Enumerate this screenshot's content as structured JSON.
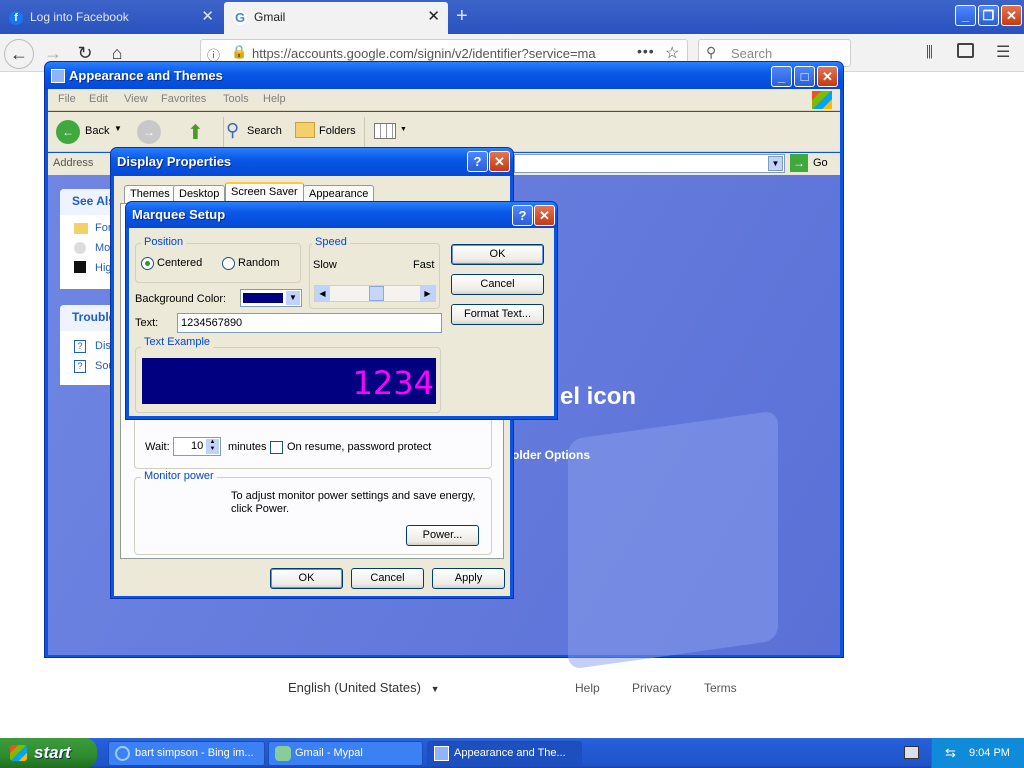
{
  "browser": {
    "tabs": [
      {
        "label": "Log into Facebook",
        "active": false
      },
      {
        "label": "Gmail",
        "active": true
      }
    ],
    "url": "https://accounts.google.com/signin/v2/identifier?service=ma",
    "search_placeholder": "Search"
  },
  "explorer": {
    "title": "Appearance and Themes",
    "menu": [
      "File",
      "Edit",
      "View",
      "Favorites",
      "Tools",
      "Help"
    ],
    "toolbar": {
      "back": "Back",
      "search": "Search",
      "folders": "Folders"
    },
    "address_label": "Address",
    "go_label": "Go",
    "see_also_header": "See Also",
    "see_also_items": [
      "Fonts",
      "Mouse Pointers",
      "High Contrast"
    ],
    "troubleshooters_header": "Troubleshooters",
    "troubleshooter_items": [
      "Display",
      "Sound"
    ],
    "panel_heading": "el icon",
    "folder_options": "older Options"
  },
  "display_properties": {
    "title": "Display Properties",
    "tabs": [
      "Themes",
      "Desktop",
      "Screen Saver",
      "Appearance"
    ],
    "wait_label": "Wait:",
    "wait_value": "10",
    "minutes_label": "minutes",
    "resume_label": "On resume, password protect",
    "monitor_power_label": "Monitor power",
    "monitor_power_text": "To adjust monitor power settings and save energy, click Power.",
    "power_button": "Power...",
    "ok": "OK",
    "cancel": "Cancel",
    "apply": "Apply"
  },
  "marquee": {
    "title": "Marquee Setup",
    "position_label": "Position",
    "centered_label": "Centered",
    "random_label": "Random",
    "speed_label": "Speed",
    "slow_label": "Slow",
    "fast_label": "Fast",
    "speed_value": 0.5,
    "bg_color_label": "Background Color:",
    "bg_color": "#000080",
    "text_label": "Text:",
    "text_value": "1234567890",
    "text_example_label": "Text Example",
    "preview_text": "1234",
    "preview_color": "#ff00ff",
    "ok": "OK",
    "cancel": "Cancel",
    "format_text": "Format Text..."
  },
  "google_footer": {
    "language": "English (United States)",
    "help": "Help",
    "privacy": "Privacy",
    "terms": "Terms"
  },
  "taskbar": {
    "start": "start",
    "tasks": [
      {
        "label": "bart simpson - Bing im...",
        "active": false
      },
      {
        "label": "Gmail - Mypal",
        "active": false
      },
      {
        "label": "Appearance and The...",
        "active": true
      }
    ],
    "clock": "9:04 PM"
  }
}
